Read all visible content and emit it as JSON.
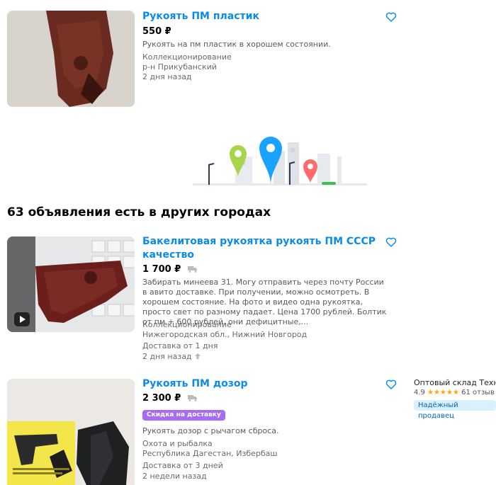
{
  "listings": [
    {
      "title": "Рукоять ПМ пластик",
      "price": "550 ₽",
      "description": "Рукоять на пм пластик в хорошем состоянии.",
      "category": "Коллекционирование",
      "location": "р-н Прикубанский",
      "date": "2 дня назад"
    },
    {
      "title": "Бакелитовая рукоятка рукоять ПМ СССР качество",
      "price": "1 700 ₽",
      "description": "Забирать минеева 31. Могу отправить через почту России в авито доставке. При получении, можно осмотреть. В хорошем состояние. На фото и видео одна рукоятка, просто свет по разному падает. Цена 1700 рублей. Болтик от пм + 600 рублей, они дефицитные,...",
      "category": "Коллекционирование",
      "location": "Нижегородская обл., Нижний Новгород",
      "delivery": "Доставка от 1 дня",
      "date": "2 дня назад"
    },
    {
      "title": "Рукоять ПМ дозор",
      "price": "2 300 ₽",
      "badge": "Скидка на доставку",
      "description": "Рукоять дозор с рычагом сброса.",
      "category": "Охота и рыбалка",
      "location": "Республика Дагестан, Избербаш",
      "delivery": "Доставка от 3 дней",
      "date": "2 недели назад",
      "seller": {
        "name": "Оптовый склад Техно-I",
        "rating": "4.9",
        "stars": "★★★★★",
        "reviews": "61 отзыв",
        "badge": "Надёжный продавец"
      }
    }
  ],
  "section_title": "63 объявления есть в других городах",
  "colors": {
    "link": "#0a8bea",
    "badge_purple": "#a76bf5",
    "star": "#ffa600"
  },
  "icons": {
    "favorite": "heart-outline-icon",
    "delivery": "truck-icon",
    "promoted": "arrow-up-icon",
    "video": "play-icon"
  }
}
